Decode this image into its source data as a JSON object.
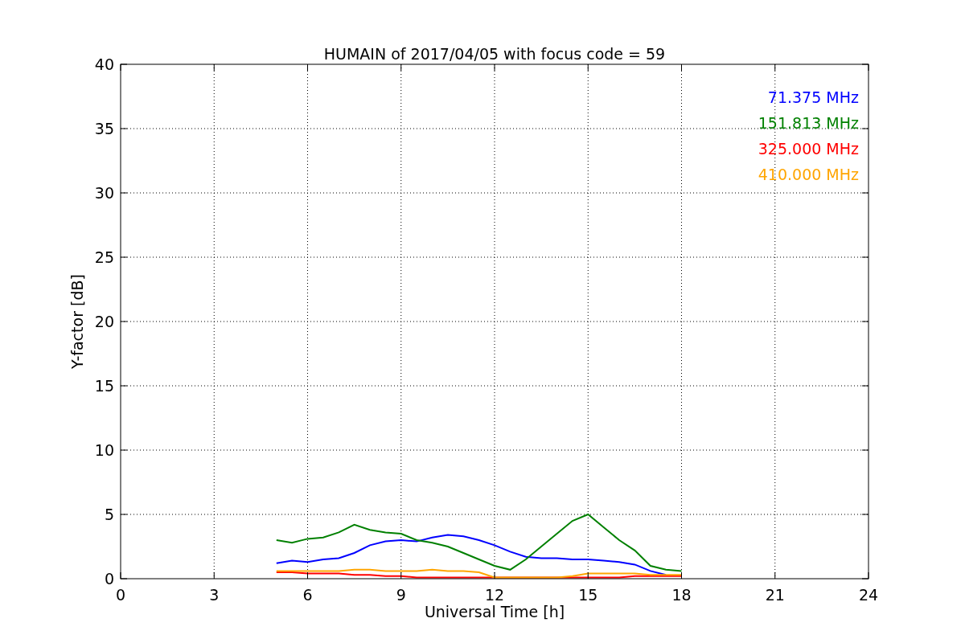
{
  "chart_data": {
    "type": "line",
    "title": "HUMAIN of 2017/04/05 with focus code = 59",
    "xlabel": "Universal Time [h]",
    "ylabel": "Y-factor [dB]",
    "x": [
      5,
      5.5,
      6,
      6.5,
      7,
      7.5,
      8,
      8.5,
      9,
      9.5,
      10,
      10.5,
      11,
      11.5,
      12,
      12.5,
      13,
      13.5,
      14,
      14.5,
      15,
      15.5,
      16,
      16.5,
      17,
      17.5,
      18
    ],
    "series": [
      {
        "name": "71.375 MHz",
        "color": "#0000ff",
        "values": [
          1.2,
          1.4,
          1.3,
          1.5,
          1.6,
          2.0,
          2.6,
          2.9,
          3.0,
          2.9,
          3.2,
          3.4,
          3.3,
          3.0,
          2.6,
          2.1,
          1.7,
          1.6,
          1.6,
          1.5,
          1.5,
          1.4,
          1.3,
          1.1,
          0.6,
          0.3,
          null
        ]
      },
      {
        "name": "151.813 MHz",
        "color": "#008000",
        "values": [
          3.0,
          2.8,
          3.1,
          3.2,
          3.6,
          4.2,
          3.8,
          3.6,
          3.5,
          3.0,
          2.8,
          2.5,
          2.0,
          1.5,
          1.0,
          0.7,
          1.5,
          2.5,
          3.5,
          4.5,
          5.0,
          4.0,
          3.0,
          2.2,
          1.0,
          0.7,
          0.6
        ]
      },
      {
        "name": "325.000 MHz",
        "color": "#ff0000",
        "values": [
          0.5,
          0.5,
          0.4,
          0.4,
          0.4,
          0.3,
          0.3,
          0.2,
          0.2,
          0.1,
          0.1,
          0.1,
          0.1,
          0.1,
          0.1,
          0.1,
          0.1,
          0.1,
          0.1,
          0.1,
          0.1,
          0.1,
          0.1,
          0.2,
          0.2,
          0.2,
          0.2
        ]
      },
      {
        "name": "410.000 MHz",
        "color": "#ffa500",
        "values": [
          0.6,
          0.6,
          0.6,
          0.6,
          0.6,
          0.7,
          0.7,
          0.6,
          0.6,
          0.6,
          0.7,
          0.6,
          0.6,
          0.5,
          0.1,
          0.1,
          0.1,
          0.1,
          0.1,
          0.2,
          0.4,
          0.4,
          0.4,
          0.4,
          0.3,
          0.3,
          0.3
        ]
      }
    ],
    "grid": true,
    "xlim": [
      0,
      24
    ],
    "ylim": [
      0,
      40
    ],
    "xticks": [
      0,
      3,
      6,
      9,
      12,
      15,
      18,
      21,
      24
    ],
    "yticks": [
      0,
      5,
      10,
      15,
      20,
      25,
      30,
      35,
      40
    ]
  }
}
